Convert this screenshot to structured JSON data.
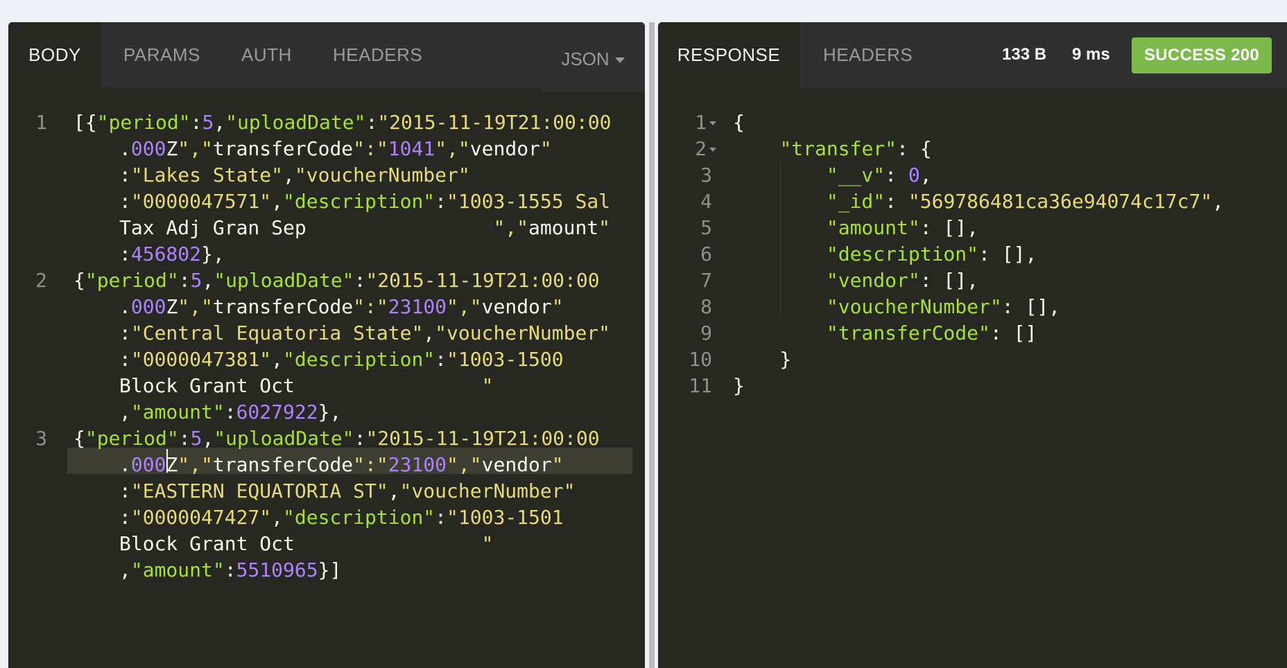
{
  "request": {
    "tabs": [
      {
        "label": "BODY",
        "active": true
      },
      {
        "label": "PARAMS",
        "active": false
      },
      {
        "label": "AUTH",
        "active": false
      },
      {
        "label": "HEADERS",
        "active": false
      }
    ],
    "format_dropdown": "JSON",
    "line_numbers": [
      "1",
      "2",
      "3"
    ],
    "body_lines": [
      "[{\"period\":5,\"uploadDate\":\"2015-11-19T21:00:00",
      ".000Z\",\"transferCode\":\"1041\",\"vendor\"",
      ":\"Lakes State\",\"voucherNumber\"",
      ":\"0000047571\",\"description\":\"1003-1555 Sal",
      "Tax Adj Gran Sep                \",\"amount\"",
      ":456802},",
      "{\"period\":5,\"uploadDate\":\"2015-11-19T21:00:00",
      ".000Z\",\"transferCode\":\"23100\",\"vendor\"",
      ":\"Central Equatoria State\",\"voucherNumber\"",
      ":\"0000047381\",\"description\":\"1003-1500",
      "Block Grant Oct                \"",
      ",\"amount\":6027922},",
      "{\"period\":5,\"uploadDate\":\"2015-11-19T21:00:00",
      ".000Z\",\"transferCode\":\"23100\",\"vendor\"",
      ":\"EASTERN EQUATORIA ST\",\"voucherNumber\"",
      ":\"0000047427\",\"description\":\"1003-1501",
      "Block Grant Oct                \"",
      ",\"amount\":5510965}]"
    ]
  },
  "response": {
    "tabs": [
      {
        "label": "RESPONSE",
        "active": true
      },
      {
        "label": "HEADERS",
        "active": false
      }
    ],
    "size": "133 B",
    "time": "9 ms",
    "status_badge": "SUCCESS 200",
    "line_numbers": [
      "1",
      "2",
      "3",
      "4",
      "5",
      "6",
      "7",
      "8",
      "9",
      "10",
      "11"
    ],
    "body_lines": [
      "{",
      "    \"transfer\": {",
      "        \"__v\": 0,",
      "        \"_id\": \"569786481ca36e94074c17c7\",",
      "        \"amount\": [],",
      "        \"description\": [],",
      "        \"vendor\": [],",
      "        \"voucherNumber\": [],",
      "        \"transferCode\": []",
      "    }",
      "}"
    ]
  },
  "colors": {
    "editor_bg": "#272822",
    "tabbar_bg": "#303030",
    "success_badge": "#7cba4c",
    "key": "#a6e22e",
    "string": "#e6db74",
    "number": "#ae81ff"
  }
}
